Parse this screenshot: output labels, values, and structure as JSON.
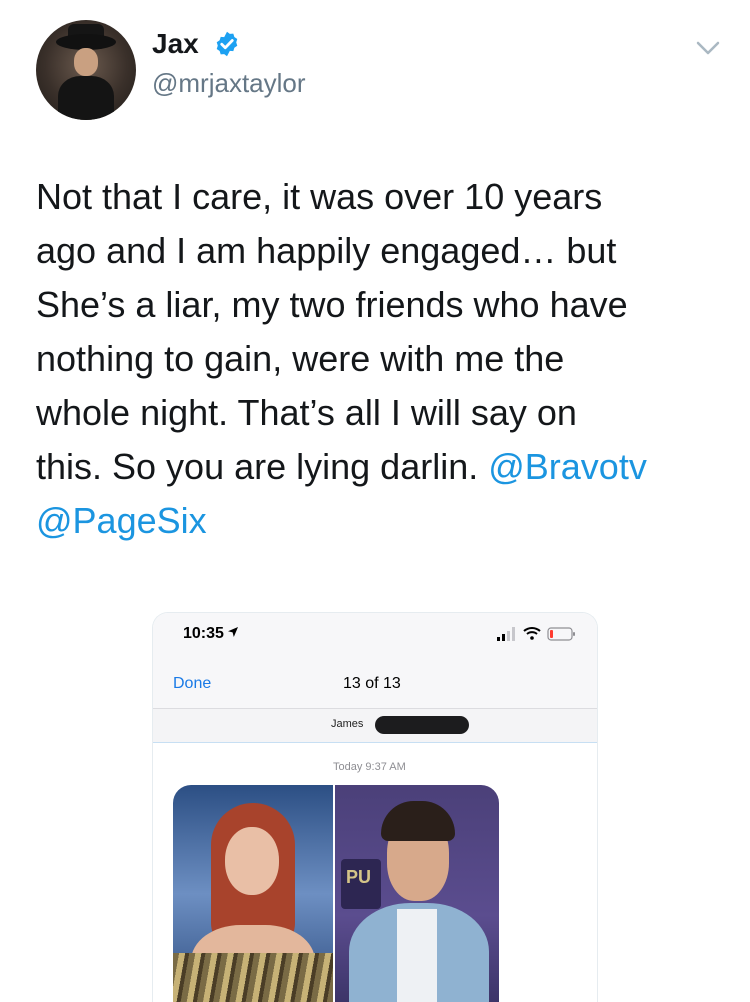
{
  "user": {
    "name": "Jax",
    "handle": "@mrjaxtaylor"
  },
  "tweet": {
    "text_plain": "Not that I care, it was over 10 years\nago and I am happily engaged… but\nShe’s a liar, my two friends who have\nnothing to gain, were with me the\nwhole night. That’s all I will say on\nthis. So you are lying darlin. ",
    "mention_1": "@Bravotv",
    "mention_2": "@PageSix"
  },
  "media": {
    "status_time": "10:35",
    "nav_done": "Done",
    "nav_count": "13 of 13",
    "contact_name": "James",
    "timestamp": "Today 9:37 AM",
    "sign_text": "PU"
  },
  "icons": {
    "verified": "verified-badge-icon",
    "chevron": "chevron-down-icon",
    "location": "location-arrow-icon",
    "signal": "cellular-signal-icon",
    "wifi": "wifi-icon",
    "battery": "battery-icon"
  },
  "colors": {
    "link": "#1b95e0",
    "verified": "#1da1f2",
    "secondary_text": "#657786",
    "ios_blue": "#1a7ae6"
  }
}
